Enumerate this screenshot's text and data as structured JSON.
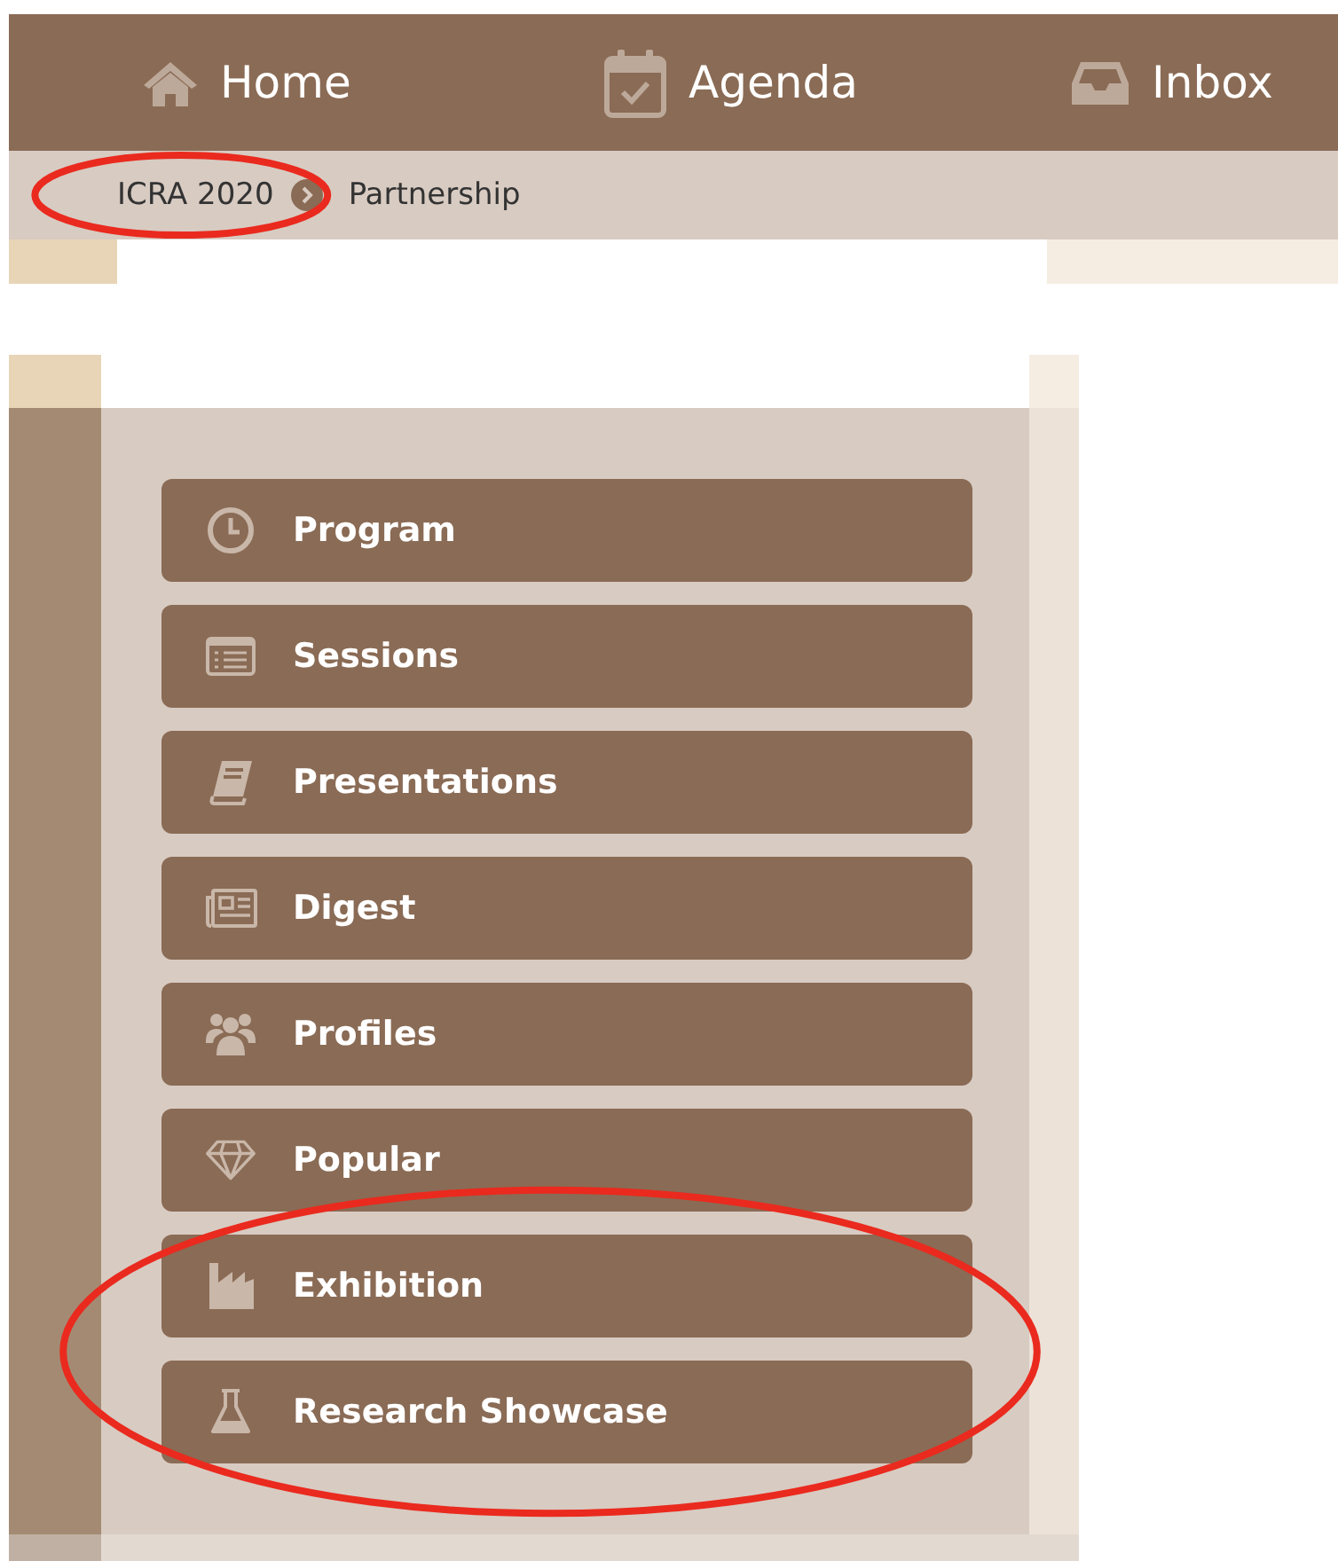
{
  "nav": [
    {
      "label": "Home"
    },
    {
      "label": "Agenda"
    },
    {
      "label": "Inbox"
    }
  ],
  "breadcrumb": [
    {
      "label": "ICRA 2020",
      "circled": true
    },
    {
      "label": "Partnership",
      "circled": false
    }
  ],
  "menu": [
    {
      "label": "Program",
      "circled": false
    },
    {
      "label": "Sessions",
      "circled": false
    },
    {
      "label": "Presentations",
      "circled": false
    },
    {
      "label": "Digest",
      "circled": false
    },
    {
      "label": "Profiles",
      "circled": false
    },
    {
      "label": "Popular",
      "circled": false
    },
    {
      "label": "Exhibition",
      "circled": true
    },
    {
      "label": "Research Showcase",
      "circled": true
    }
  ]
}
